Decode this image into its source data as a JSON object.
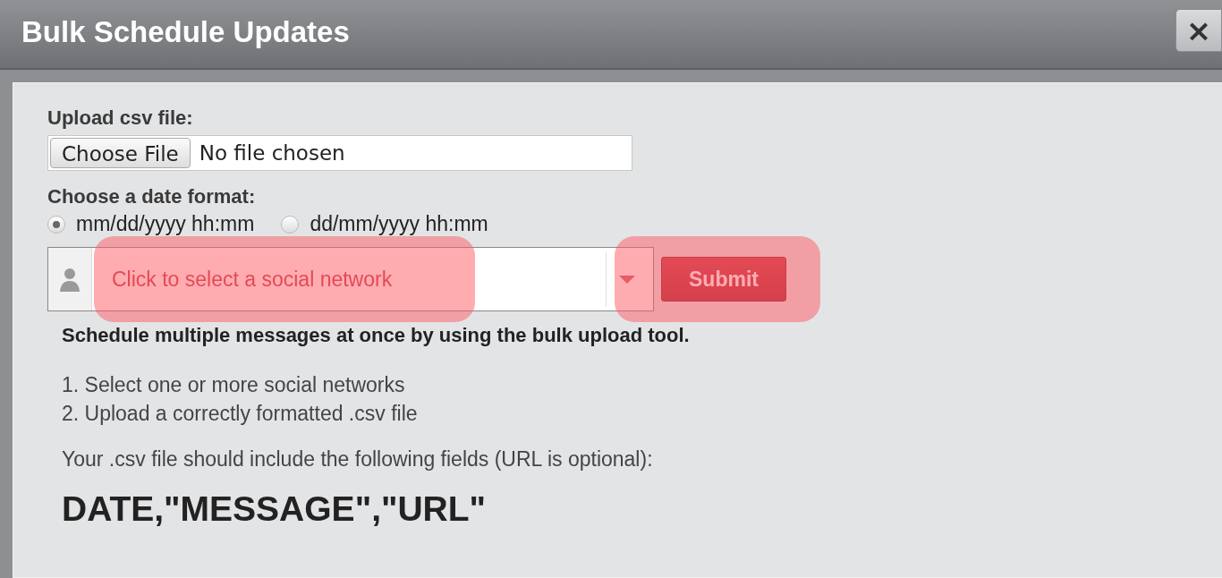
{
  "dialog": {
    "title": "Bulk Schedule Updates",
    "close": "×"
  },
  "upload": {
    "label": "Upload csv file:",
    "button": "Choose File",
    "status": "No file chosen"
  },
  "date_format": {
    "label": "Choose a date format:",
    "options": [
      {
        "label": "mm/dd/yyyy hh:mm",
        "selected": true
      },
      {
        "label": "dd/mm/yyyy hh:mm",
        "selected": false
      }
    ]
  },
  "network_select": {
    "placeholder": "Click to select a social network",
    "highlighted": true
  },
  "submit": {
    "label": "Submit",
    "highlighted": true
  },
  "intro": "Schedule multiple messages at once by using the bulk upload tool.",
  "steps": [
    "1. Select one or more social networks",
    "2. Upload a correctly formatted .csv file"
  ],
  "fields_note": "Your .csv file should include the following fields (URL is optional):",
  "format_example": "DATE,\"MESSAGE\",\"URL\""
}
